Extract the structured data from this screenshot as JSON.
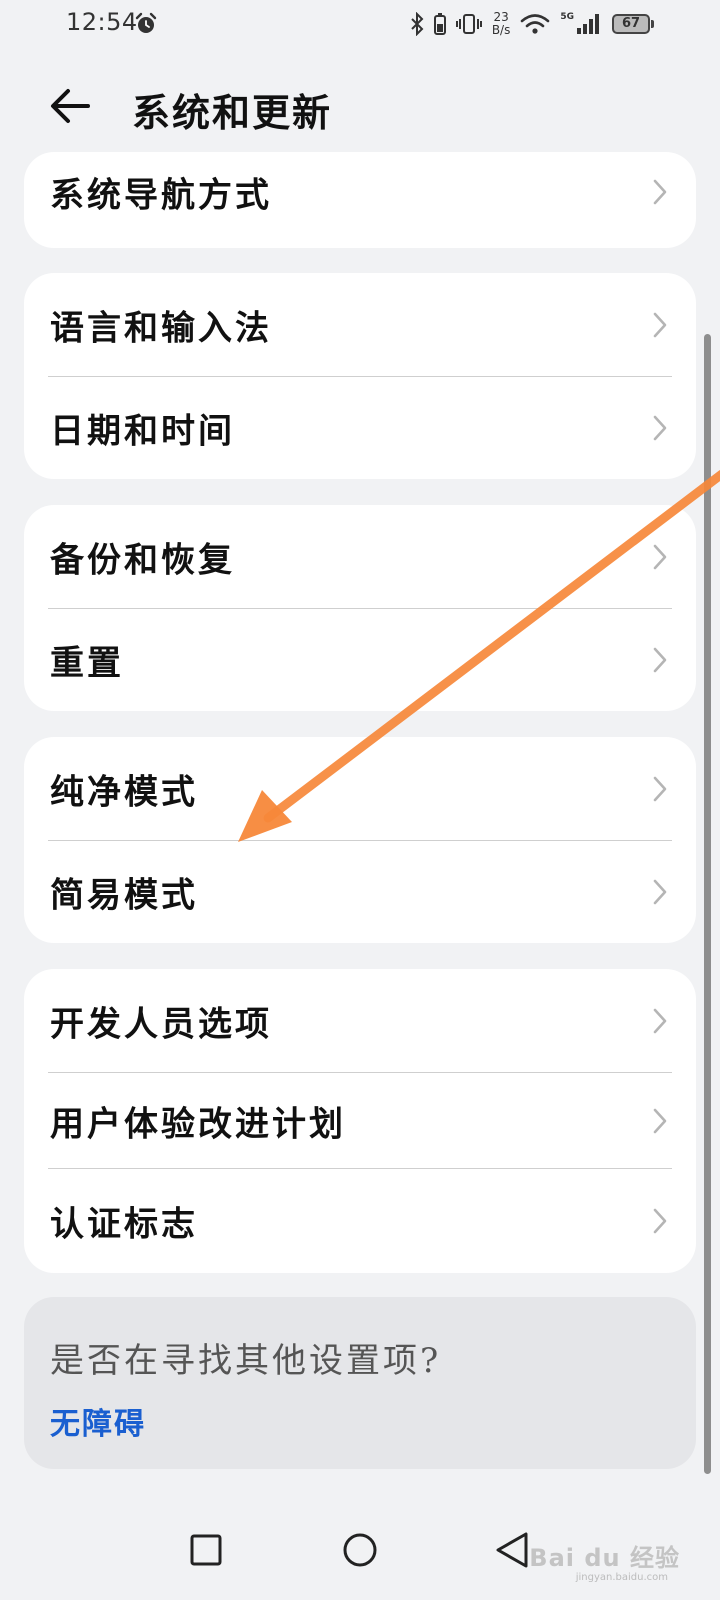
{
  "status_bar": {
    "time": "12:54",
    "net_speed_value": "23",
    "net_speed_unit": "B/s",
    "network": "5G",
    "battery_level": "67"
  },
  "header": {
    "title": "系统和更新"
  },
  "groups": [
    {
      "items": [
        {
          "label": "系统导航方式",
          "icon": "chevron-right-icon"
        }
      ]
    },
    {
      "items": [
        {
          "label": "语言和输入法",
          "icon": "chevron-right-icon"
        },
        {
          "label": "日期和时间",
          "icon": "chevron-right-icon"
        }
      ]
    },
    {
      "items": [
        {
          "label": "备份和恢复",
          "icon": "chevron-right-icon"
        },
        {
          "label": "重置",
          "icon": "chevron-right-icon"
        }
      ]
    },
    {
      "items": [
        {
          "label": "纯净模式",
          "icon": "chevron-right-icon"
        },
        {
          "label": "简易模式",
          "icon": "chevron-right-icon"
        }
      ]
    },
    {
      "items": [
        {
          "label": "开发人员选项",
          "icon": "chevron-right-icon"
        },
        {
          "label": "用户体验改进计划",
          "icon": "chevron-right-icon"
        },
        {
          "label": "认证标志",
          "icon": "chevron-right-icon"
        }
      ]
    }
  ],
  "help_card": {
    "question": "是否在寻找其他设置项?",
    "link": "无障碍"
  },
  "nav_bar": {
    "recents": "square-icon",
    "home": "circle-icon",
    "back": "triangle-back-icon"
  },
  "watermark": {
    "brand": "Bai du 经验",
    "url": "jingyan.baidu.com"
  },
  "colors": {
    "background": "#f1f2f4",
    "card": "#ffffff",
    "help_card": "#e5e6e9",
    "link": "#1a5fd0",
    "annotation_arrow": "#f7883a"
  }
}
